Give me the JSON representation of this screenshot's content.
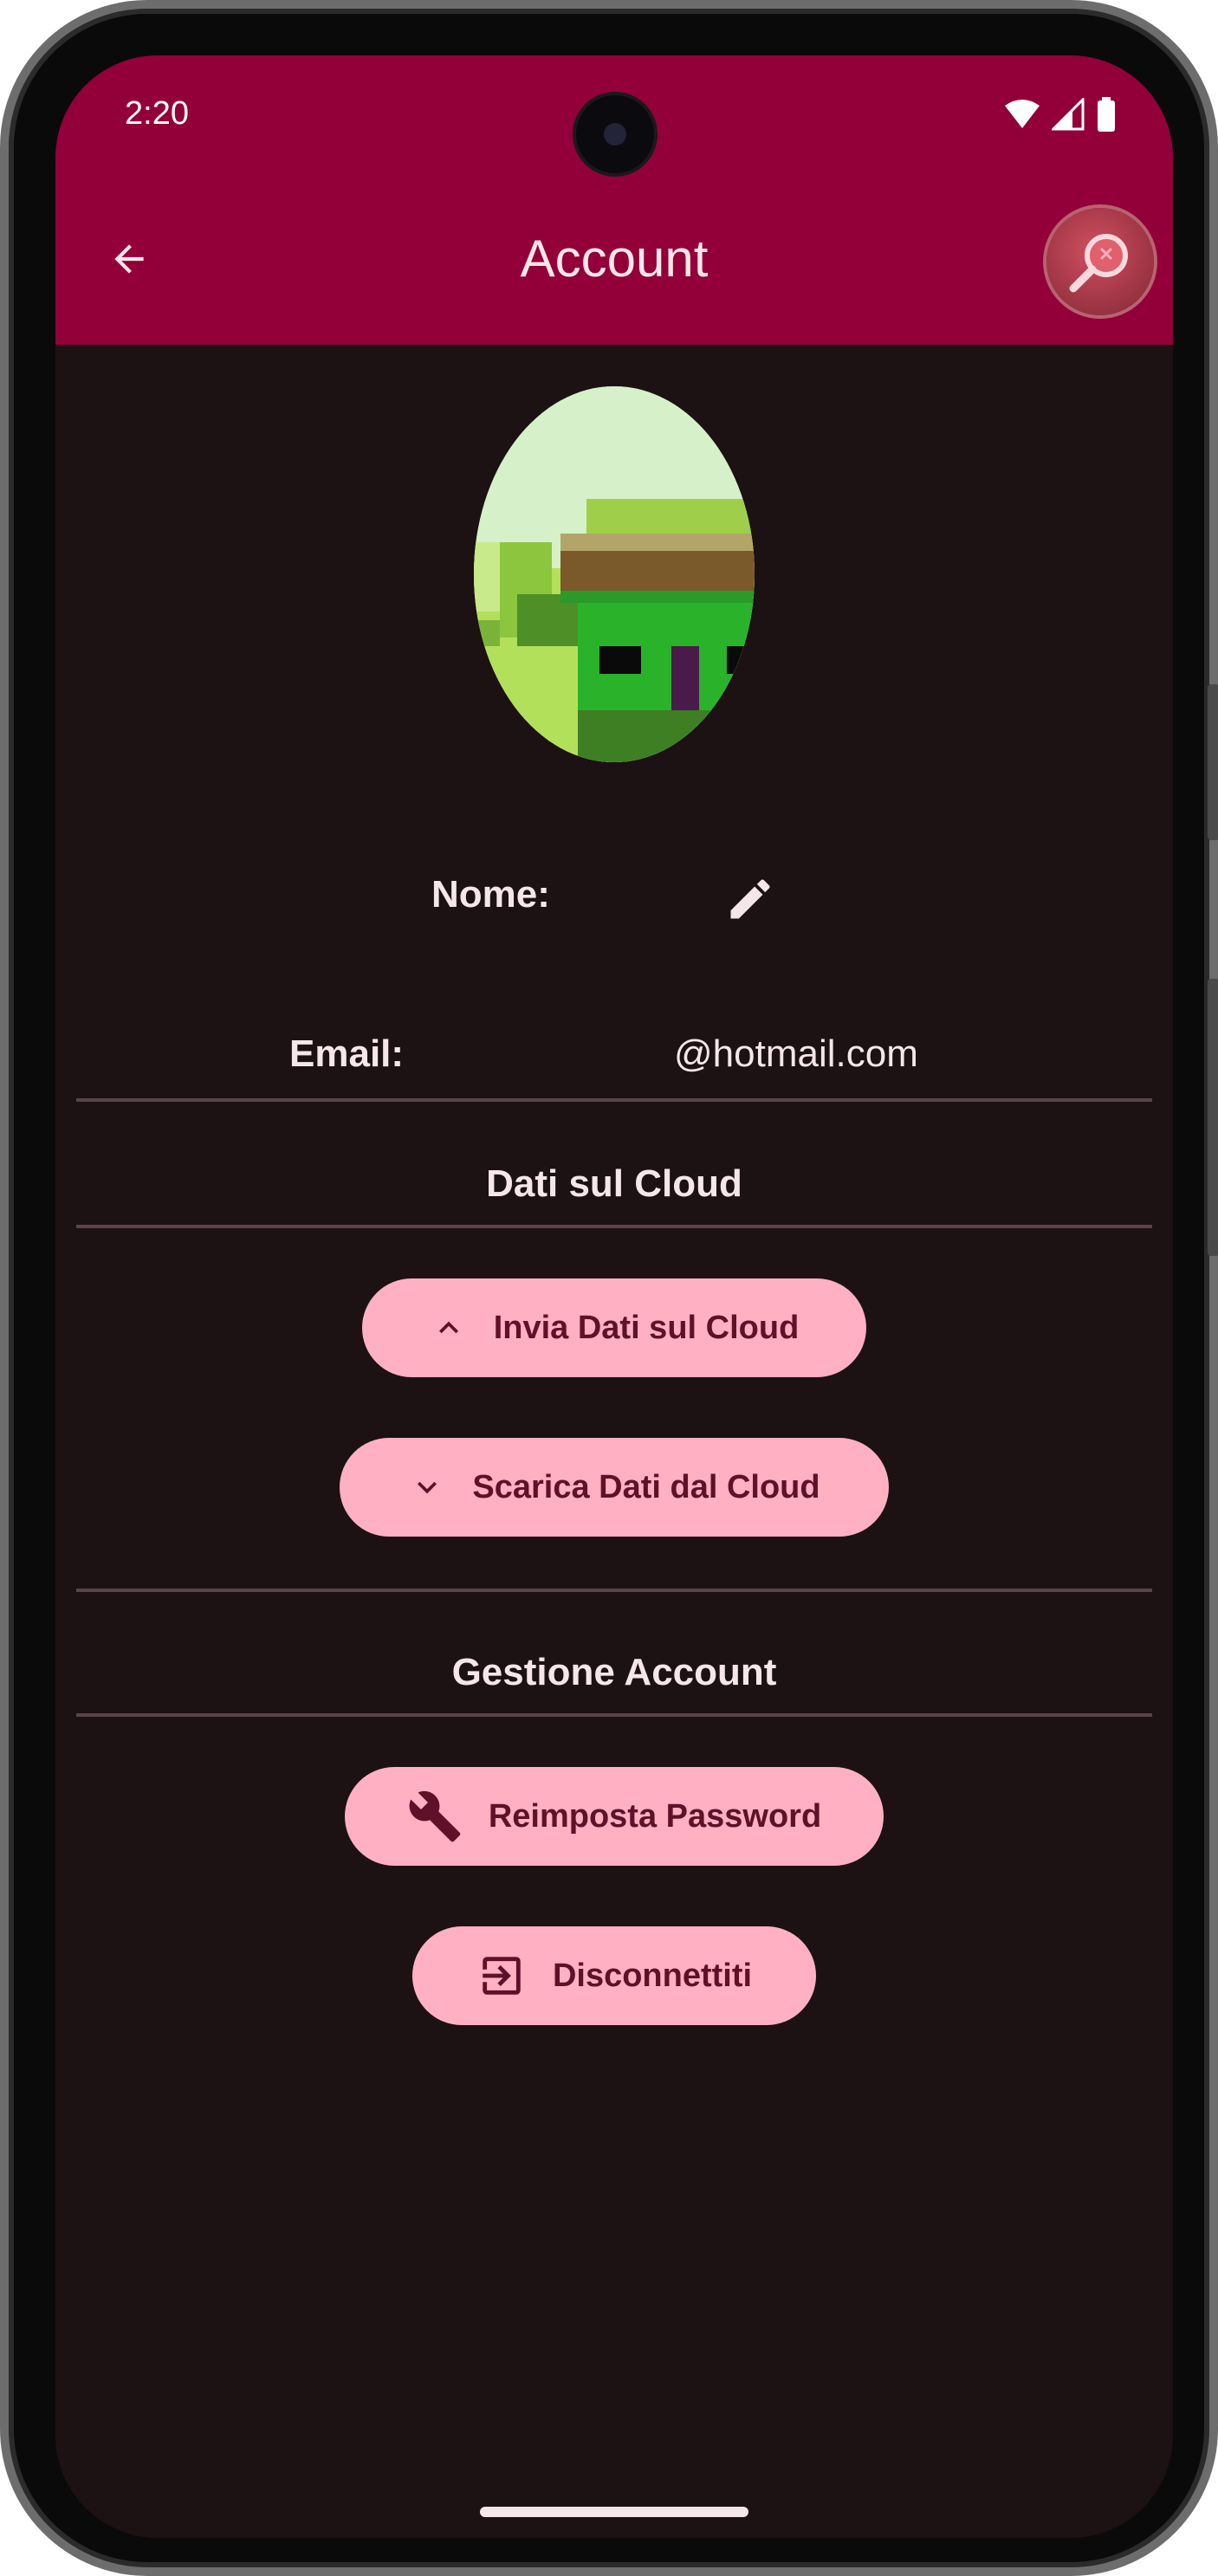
{
  "status_bar": {
    "time": "2:20"
  },
  "app_bar": {
    "title": "Account",
    "back_icon": "arrow-back-icon",
    "search_icon": "search-magnifier-icon",
    "color": "#930039"
  },
  "profile": {
    "name_label": "Nome:",
    "name_value": "",
    "email_label": "Email:",
    "email_value": "@hotmail.com"
  },
  "sections": {
    "cloud_title": "Dati sul Cloud",
    "account_title": "Gestione Account"
  },
  "buttons": {
    "upload_label": "Invia Dati sul Cloud",
    "download_label": "Scarica Dati dal Cloud",
    "reset_password_label": "Reimposta Password",
    "logout_label": "Disconnettiti"
  },
  "colors": {
    "background": "#1c1113",
    "button_fill": "#ffb1c3",
    "button_text": "#5f1129",
    "text": "#f5e6ea"
  }
}
